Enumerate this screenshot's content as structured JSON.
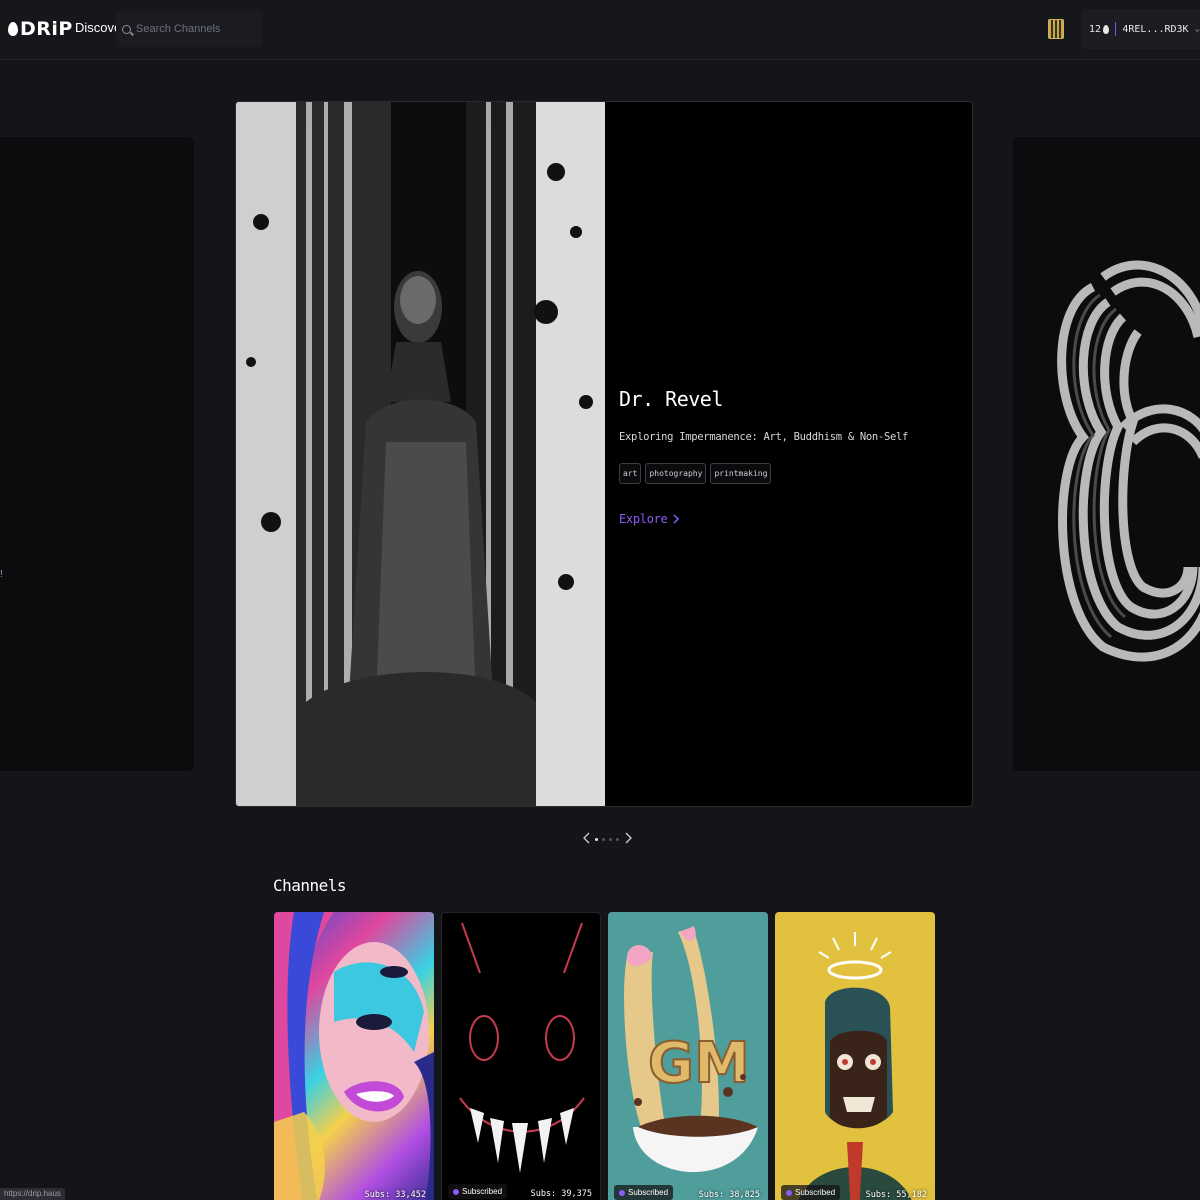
{
  "header": {
    "logo_text": "DRiP",
    "nav_discover": "Discover",
    "search_placeholder": "Search Channels",
    "wallet": {
      "balance": "12",
      "address": "4REL...RD3K"
    }
  },
  "left_card": {
    "visible_text": "!"
  },
  "hero": {
    "title": "Dr. Revel",
    "subtitle": "Exploring Impermanence: Art, Buddhism & Non-Self",
    "tags": [
      "art",
      "photography",
      "printmaking"
    ],
    "explore_label": "Explore"
  },
  "carousel": {
    "dot_count": 4,
    "active_index": 0
  },
  "channels_section": {
    "title": "Channels",
    "items": [
      {
        "subscribed": false,
        "subscribed_label": "",
        "subs": "Subs: 33,452"
      },
      {
        "subscribed": true,
        "subscribed_label": "Subscribed",
        "subs": "Subs: 39,375"
      },
      {
        "subscribed": true,
        "subscribed_label": "Subscribed",
        "subs": "Subs: 38,825"
      },
      {
        "subscribed": true,
        "subscribed_label": "Subscribed",
        "subs": "Subs: 55,182"
      }
    ]
  },
  "colors": {
    "background": "#141519",
    "accent": "#8b5cf6",
    "hero_bg": "#000000"
  },
  "status_bar_text": "https://drip.haus"
}
